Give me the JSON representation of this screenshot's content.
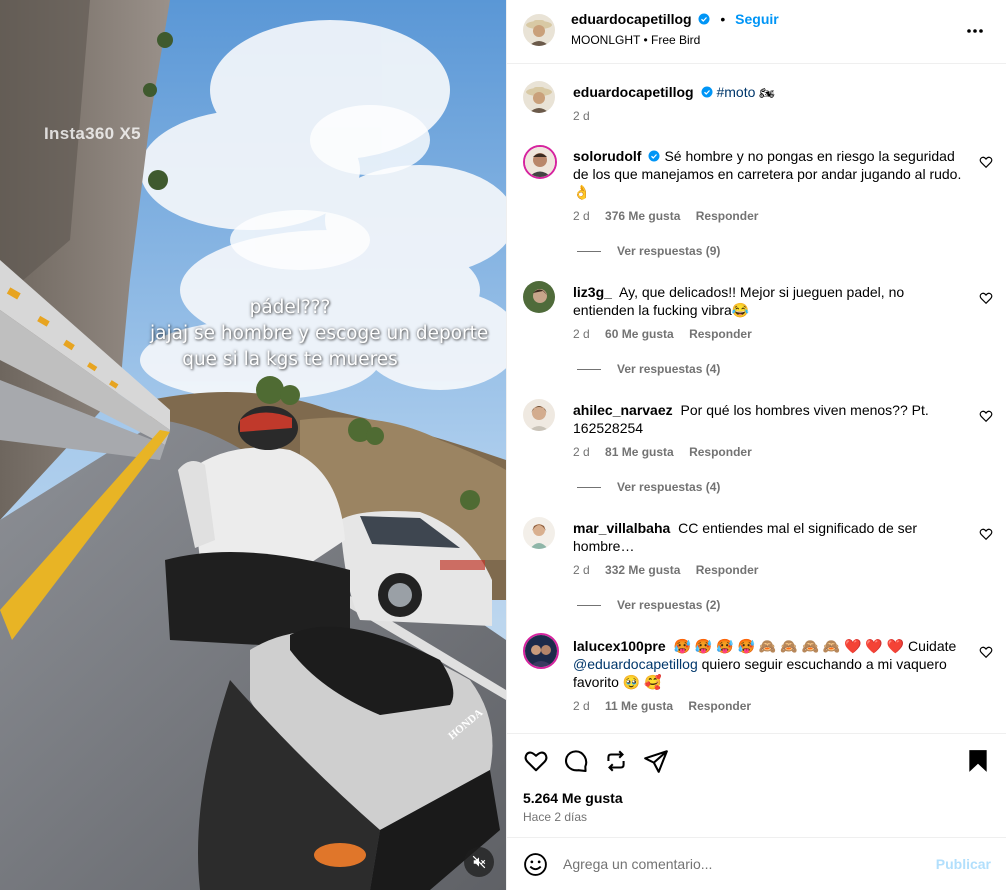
{
  "media": {
    "watermark": "Insta360 X5",
    "overlay_lines": [
      "pádel???",
      "jajaj se hombre y escoge un deporte",
      "que si la kgs te mueres"
    ],
    "helmet_brand": "HONDA"
  },
  "header": {
    "username": "eduardocapetillog",
    "follow_label": "Seguir",
    "audio": "MOONLGHT • Free Bird"
  },
  "caption": {
    "username": "eduardocapetillog",
    "hashtag": "#moto",
    "emoji": "🏍",
    "time": "2 d"
  },
  "comments": [
    {
      "username": "solorudolf",
      "verified": true,
      "text": "Sé hombre y no pongas en riesgo la seguridad de los que manejamos en carretera por andar jugando al rudo. 👌",
      "time": "2 d",
      "likes": "376 Me gusta",
      "reply": "Responder",
      "view_replies": "Ver respuestas (9)"
    },
    {
      "username": "liz3g_",
      "text": "Ay, que delicados!! Mejor si jueguen padel, no entienden la fucking vibra😂",
      "time": "2 d",
      "likes": "60 Me gusta",
      "reply": "Responder",
      "view_replies": "Ver respuestas (4)"
    },
    {
      "username": "ahilec_narvaez",
      "text": "Por qué los hombres viven menos?? Pt. 162528254",
      "time": "2 d",
      "likes": "81 Me gusta",
      "reply": "Responder",
      "view_replies": "Ver respuestas (4)"
    },
    {
      "username": "mar_villalbaha",
      "text": "CC entiendes mal el significado de ser hombre…",
      "time": "2 d",
      "likes": "332 Me gusta",
      "reply": "Responder",
      "view_replies": "Ver respuestas (2)"
    },
    {
      "username": "lalucex100pre",
      "text_before": "🥵 🥵 🥵 🥵 🙈 🙈 🙈 🙈 ❤️ ❤️ ❤️ Cuidate ",
      "mention": "@eduardocapetillog",
      "text_after": " quiero seguir escuchando a mi vaquero favorito 🥹 🥰",
      "time": "2 d",
      "likes": "11 Me gusta",
      "reply": "Responder"
    }
  ],
  "footer": {
    "likes": "5.264 Me gusta",
    "time_ago": "Hace 2 días",
    "comment_placeholder": "Agrega un comentario...",
    "post_label": "Publicar"
  },
  "colors": {
    "accent": "#0095f6",
    "link": "#00376b",
    "muted": "#737373",
    "like_red": "#ff3040"
  }
}
